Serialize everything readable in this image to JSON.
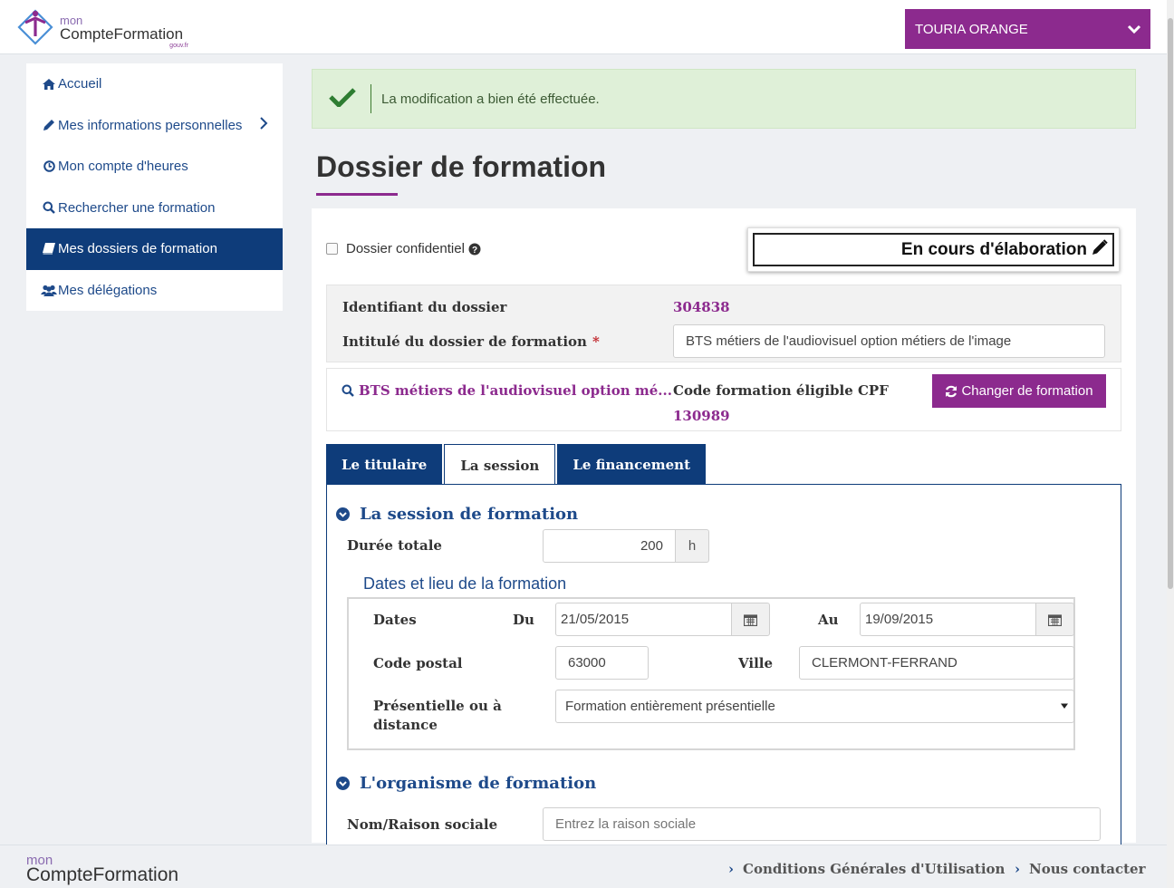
{
  "header": {
    "logo_small": "mon",
    "logo_big": "CompteFormation",
    "logo_gouv": "gouv.fr",
    "user_name": "TOURIA ORANGE"
  },
  "sidebar": {
    "items": [
      {
        "label": "Accueil",
        "icon": "home-icon"
      },
      {
        "label": "Mes informations personnelles",
        "icon": "pencil-icon"
      },
      {
        "label": "Mon compte d'heures",
        "icon": "clock-icon"
      },
      {
        "label": "Rechercher une formation",
        "icon": "search-icon"
      },
      {
        "label": "Mes dossiers de formation",
        "icon": "book-icon",
        "active": true
      },
      {
        "label": "Mes délégations",
        "icon": "users-icon"
      }
    ]
  },
  "alert": {
    "message": "La modification a bien été effectuée."
  },
  "page_title": "Dossier de formation",
  "dossier": {
    "confidential_label": "Dossier confidentiel",
    "status": "En cours d'élaboration",
    "id_label": "Identifiant du dossier",
    "id_value": "304838",
    "title_label": "Intitulé du dossier de formation",
    "title_required_mark": "*",
    "title_value": "BTS métiers de l'audiovisuel option métiers de l'image",
    "formation_link": "BTS métiers de l'audiovisuel option mé...",
    "cpf_label": "Code formation éligible CPF",
    "cpf_value": "130989",
    "change_button": "Changer de formation"
  },
  "tabs": [
    {
      "label": "Le titulaire"
    },
    {
      "label": "La session",
      "active": true
    },
    {
      "label": "Le financement"
    }
  ],
  "session": {
    "section_title": "La session de formation",
    "duree_label": "Durée totale",
    "duree_value": "200",
    "duree_unit": "h",
    "legend": "Dates et lieu de la formation",
    "dates_label": "Dates",
    "du_label": "Du",
    "du_value": "21/05/2015",
    "au_label": "Au",
    "au_value": "19/09/2015",
    "cp_label": "Code postal",
    "cp_value": "63000",
    "ville_label": "Ville",
    "ville_value": "CLERMONT-FERRAND",
    "mode_label": "Présentielle ou à distance",
    "mode_value": "Formation entièrement présentielle"
  },
  "organisme": {
    "section_title": "L'organisme de formation",
    "nom_label": "Nom/Raison sociale",
    "nom_placeholder": "Entrez la raison sociale"
  },
  "footer": {
    "logo_small": "mon",
    "logo_big": "CompteFormation",
    "cgu_link": "Conditions Générales d'Utilisation",
    "contact_link": "Nous contacter"
  },
  "colors": {
    "brand_purple": "#8c2a8e",
    "navy": "#0e3c7a",
    "link_blue": "#1e4a8a",
    "success_bg": "#dff0d8"
  }
}
